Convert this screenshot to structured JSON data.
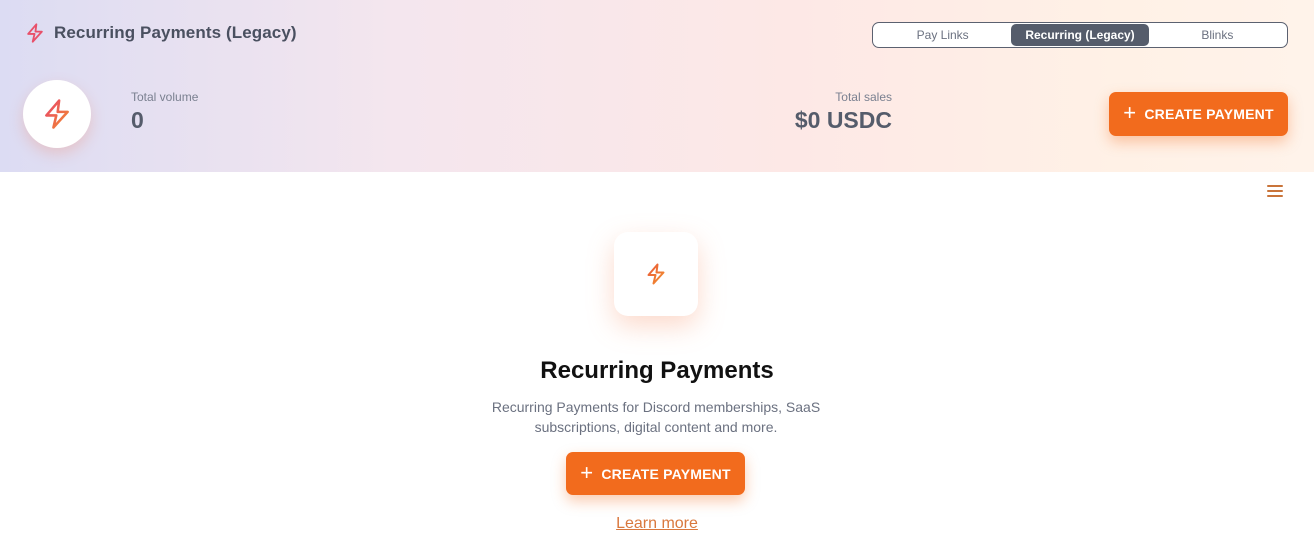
{
  "header": {
    "title": "Recurring Payments (Legacy)",
    "icon": "lightning-icon"
  },
  "tabs": [
    {
      "label": "Pay Links",
      "active": false
    },
    {
      "label": "Recurring (Legacy)",
      "active": true
    },
    {
      "label": "Blinks",
      "active": false
    }
  ],
  "stats": {
    "volume_label": "Total volume",
    "volume_value": "0",
    "sales_label": "Total sales",
    "sales_value": "$0 USDC"
  },
  "actions": {
    "create_label": "CREATE PAYMENT",
    "learn_more_label": "Learn more"
  },
  "empty_state": {
    "title": "Recurring Payments",
    "description": "Recurring Payments for Discord memberships, SaaS subscriptions, digital content and more."
  },
  "colors": {
    "accent": "#f26b1d",
    "tab_active": "#555c6b",
    "icon_gradient_start": "#e8456b",
    "icon_gradient_end": "#f28a30"
  }
}
